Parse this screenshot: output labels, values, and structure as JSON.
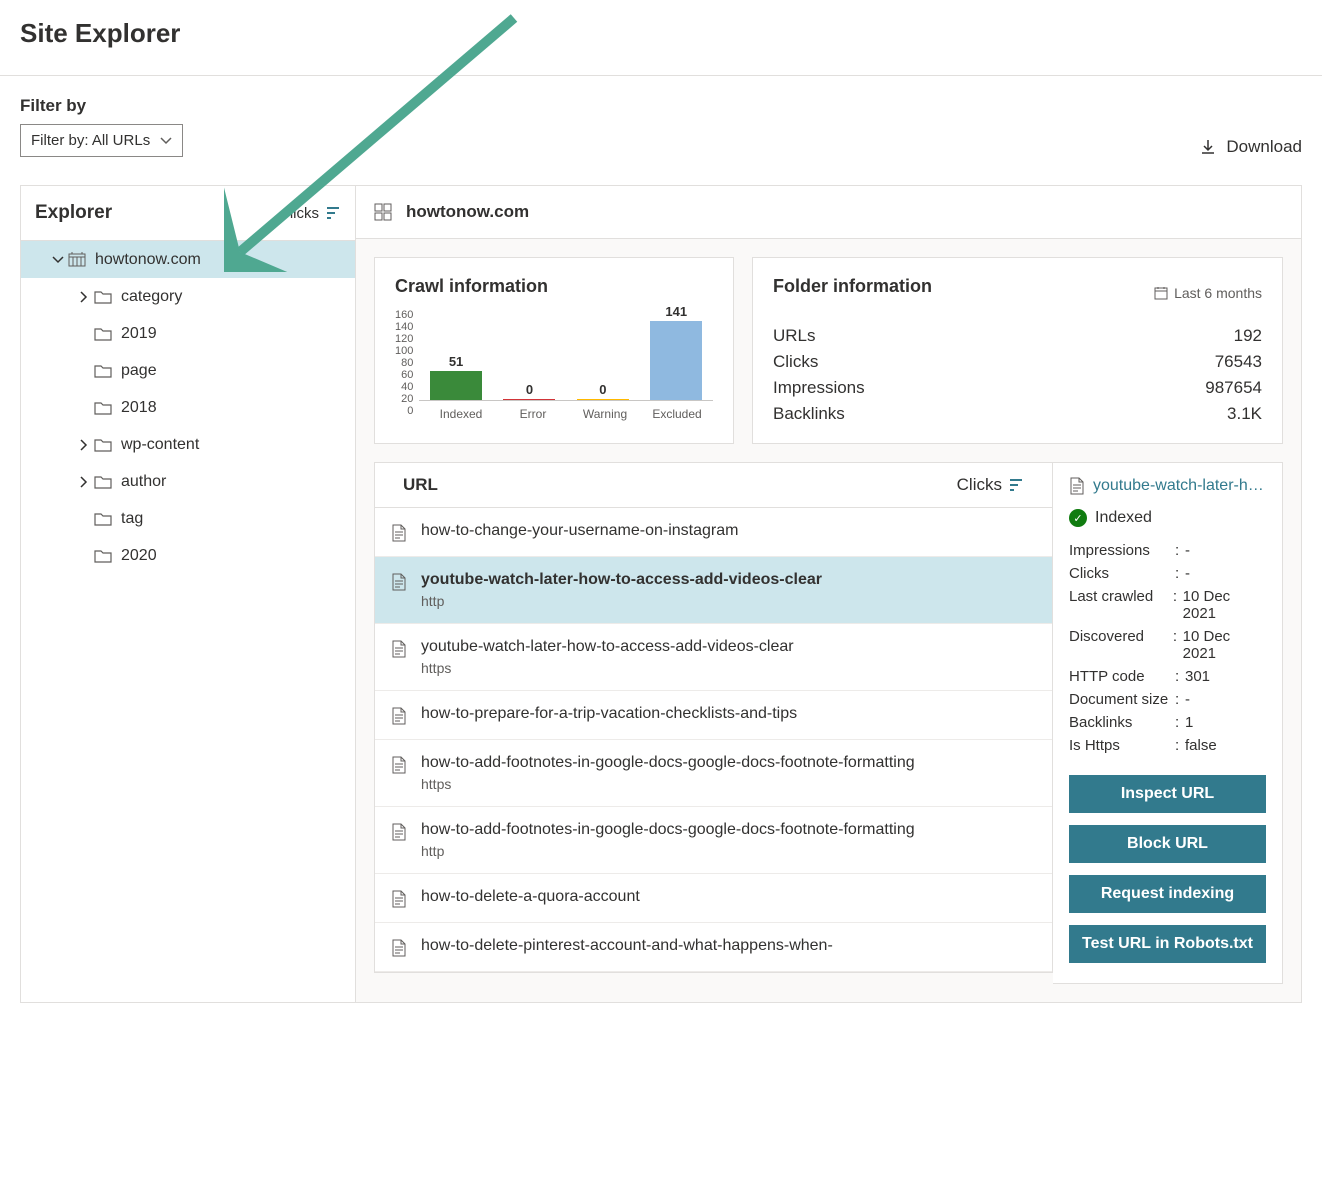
{
  "header": {
    "title": "Site Explorer"
  },
  "filter": {
    "label": "Filter by",
    "value": "Filter by: All URLs"
  },
  "download": {
    "label": "Download"
  },
  "explorer": {
    "title": "Explorer",
    "sort_label": "licks",
    "tree": [
      {
        "label": "howtonow.com",
        "depth": 0,
        "icon": "globe",
        "chevron": "down",
        "selected": true
      },
      {
        "label": "category",
        "depth": 1,
        "icon": "folder",
        "chevron": "right"
      },
      {
        "label": "2019",
        "depth": 1,
        "icon": "folder",
        "chevron": ""
      },
      {
        "label": "page",
        "depth": 1,
        "icon": "folder",
        "chevron": ""
      },
      {
        "label": "2018",
        "depth": 1,
        "icon": "folder",
        "chevron": ""
      },
      {
        "label": "wp-content",
        "depth": 1,
        "icon": "folder",
        "chevron": "right"
      },
      {
        "label": "author",
        "depth": 1,
        "icon": "folder",
        "chevron": "right"
      },
      {
        "label": "tag",
        "depth": 1,
        "icon": "folder",
        "chevron": ""
      },
      {
        "label": "2020",
        "depth": 1,
        "icon": "folder",
        "chevron": ""
      }
    ]
  },
  "content": {
    "domain": "howtonow.com",
    "crawl_title": "Crawl information",
    "folder_title": "Folder information",
    "period": "Last 6 months",
    "folder_stats": [
      {
        "label": "URLs",
        "value": "192"
      },
      {
        "label": "Clicks",
        "value": "76543"
      },
      {
        "label": "Impressions",
        "value": "987654"
      },
      {
        "label": "Backlinks",
        "value": "3.1K"
      }
    ]
  },
  "chart_data": {
    "type": "bar",
    "categories": [
      "Indexed",
      "Error",
      "Warning",
      "Excluded"
    ],
    "values": [
      51,
      0,
      0,
      141
    ],
    "colors": [
      "#3a8a3a",
      "#d13438",
      "#ffb900",
      "#8fb9e0"
    ],
    "title": "",
    "xlabel": "",
    "ylabel": "",
    "ylim": [
      0,
      160
    ],
    "yticks": [
      0,
      20,
      40,
      60,
      80,
      100,
      120,
      140,
      160
    ]
  },
  "url_table": {
    "col_url": "URL",
    "col_clicks": "Clicks",
    "rows": [
      {
        "url": "how-to-change-your-username-on-instagram",
        "scheme": "",
        "selected": false
      },
      {
        "url": "youtube-watch-later-how-to-access-add-videos-clear",
        "scheme": "http",
        "selected": true
      },
      {
        "url": "youtube-watch-later-how-to-access-add-videos-clear",
        "scheme": "https",
        "selected": false
      },
      {
        "url": "how-to-prepare-for-a-trip-vacation-checklists-and-tips",
        "scheme": "",
        "selected": false
      },
      {
        "url": "how-to-add-footnotes-in-google-docs-google-docs-footnote-formatting",
        "scheme": "https",
        "selected": false
      },
      {
        "url": "how-to-add-footnotes-in-google-docs-google-docs-footnote-formatting",
        "scheme": "http",
        "selected": false
      },
      {
        "url": "how-to-delete-a-quora-account",
        "scheme": "",
        "selected": false
      },
      {
        "url": "how-to-delete-pinterest-account-and-what-happens-when-",
        "scheme": "",
        "selected": false
      }
    ]
  },
  "detail": {
    "title": "youtube-watch-later-ho…",
    "status": "Indexed",
    "kv": [
      {
        "k": "Impressions",
        "v": "-"
      },
      {
        "k": "Clicks",
        "v": "-"
      },
      {
        "k": "Last crawled",
        "v": "10 Dec 2021"
      },
      {
        "k": "Discovered",
        "v": "10 Dec 2021"
      },
      {
        "k": "HTTP code",
        "v": "301"
      },
      {
        "k": "Document size",
        "sep_tight": true,
        "v": "-"
      },
      {
        "k": "Backlinks",
        "v": "1"
      },
      {
        "k": "Is Https",
        "v": "false"
      }
    ],
    "actions": [
      "Inspect URL",
      "Block URL",
      "Request indexing",
      "Test URL in Robots.txt"
    ]
  }
}
